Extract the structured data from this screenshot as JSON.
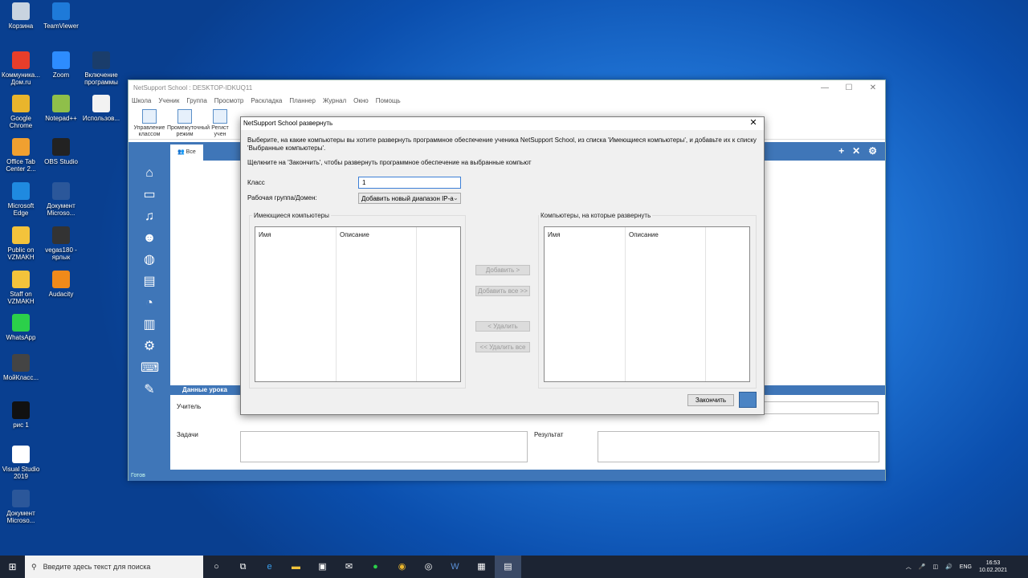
{
  "desktop": {
    "icons": [
      {
        "label": "Корзина",
        "icon": "recycle-bin-icon",
        "color": "#c9d4e0"
      },
      {
        "label": "TeamViewer",
        "icon": "teamviewer-icon",
        "color": "#1e7ad9"
      },
      {
        "label": "Коммуника... Дом.ru",
        "icon": "app-icon",
        "color": "#e83e2a"
      },
      {
        "label": "Zoom",
        "icon": "zoom-icon",
        "color": "#2d8cff"
      },
      {
        "label": "Включение программы",
        "icon": "monitor-icon",
        "color": "#1a3d6b"
      },
      {
        "label": "Google Chrome",
        "icon": "chrome-icon",
        "color": "#e9b52c"
      },
      {
        "label": "Notepad++",
        "icon": "notepad-icon",
        "color": "#8fbf4a"
      },
      {
        "label": "Использов...",
        "icon": "window-icon",
        "color": "#f2f2f2"
      },
      {
        "label": "Office Tab Center 2...",
        "icon": "office-tab-icon",
        "color": "#f0a030"
      },
      {
        "label": "OBS Studio",
        "icon": "obs-icon",
        "color": "#222222"
      },
      {
        "label": "Microsoft Edge",
        "icon": "edge-icon",
        "color": "#1f8ae0"
      },
      {
        "label": "Документ Microso...",
        "icon": "word-doc-icon",
        "color": "#2b579a"
      },
      {
        "label": "Public on VZMAKH",
        "icon": "folder-icon",
        "color": "#f3c33b"
      },
      {
        "label": "vegas180 - ярлык",
        "icon": "vegas-icon",
        "color": "#333333"
      },
      {
        "label": "Staff on VZMAKH",
        "icon": "folder-icon",
        "color": "#f3c33b"
      },
      {
        "label": "Audacity",
        "icon": "audacity-icon",
        "color": "#f08a1a"
      },
      {
        "label": "WhatsApp",
        "icon": "whatsapp-icon",
        "color": "#2bd04a"
      },
      {
        "label": "МойКласс...",
        "icon": "app-icon",
        "color": "#444444"
      },
      {
        "label": "рис 1",
        "icon": "image-icon",
        "color": "#111111"
      },
      {
        "label": "Visual Studio 2019",
        "icon": "file-icon",
        "color": "#ffffff"
      },
      {
        "label": "Документ Microso...",
        "icon": "word-doc-icon",
        "color": "#2b579a"
      }
    ]
  },
  "app": {
    "title": "NetSupport School : DESKTOP-IDKUQ11",
    "menu": [
      "Школа",
      "Ученик",
      "Группа",
      "Просмотр",
      "Раскладка",
      "Планнер",
      "Журнал",
      "Окно",
      "Помощь"
    ],
    "ribbon": [
      {
        "line1": "Управление",
        "line2": "классом"
      },
      {
        "line1": "Промежуточный",
        "line2": "режим"
      },
      {
        "line1": "Регист",
        "line2": "учен"
      }
    ],
    "tab": "Все",
    "lesson": {
      "header": "Данные урока",
      "teacher_label": "Учитель",
      "tasks_label": "Задачи",
      "result_label": "Результат"
    },
    "status": "Готов"
  },
  "dialog": {
    "title": "NetSupport School развернуть",
    "intro": "Выберите, на какие компьютеры вы хотите развернуть программное обеспечение ученика NetSupport School, из списка 'Имеющиеся компьютеры', и добавьте их к списку 'Выбранные компьютеры'.",
    "hint": "Щелкните на 'Закончить', чтобы развернуть программное обеспечение на выбранные компьют",
    "class_label": "Класс",
    "class_value": "1",
    "workgroup_label": "Рабочая группа/Домен:",
    "workgroup_value": "Добавить новый диапазон IP-а",
    "available_label": "Имеющиеся компьютеры",
    "target_label": "Компьютеры, на которые развернуть",
    "col_name": "Имя",
    "col_desc": "Описание",
    "btn_add": "Добавить >",
    "btn_add_all": "Добавить все >>",
    "btn_remove": "< Удалить",
    "btn_remove_all": "<< Удалить все",
    "btn_finish": "Закончить"
  },
  "taskbar": {
    "search_placeholder": "Введите здесь текст для поиска",
    "lang": "ENG",
    "time": "16:53",
    "date": "10.02.2021"
  }
}
